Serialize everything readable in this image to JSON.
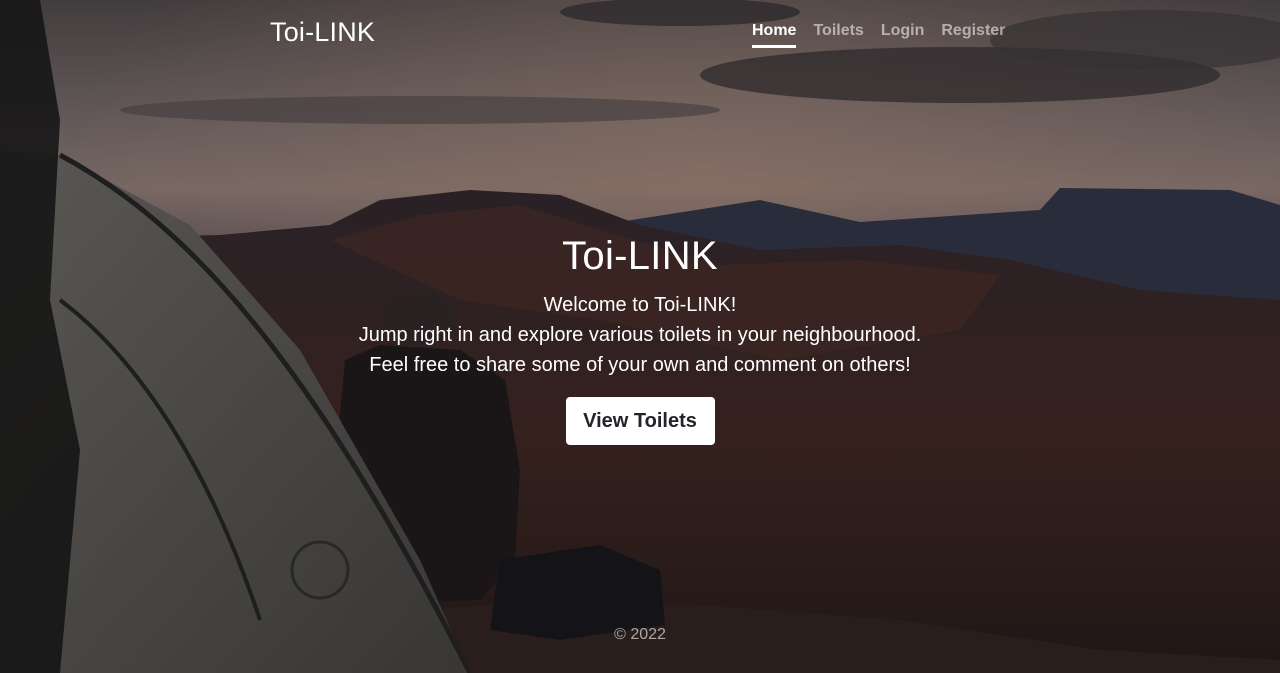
{
  "header": {
    "brand": "Toi-LINK",
    "nav": [
      {
        "label": "Home",
        "active": true
      },
      {
        "label": "Toilets",
        "active": false
      },
      {
        "label": "Login",
        "active": false
      },
      {
        "label": "Register",
        "active": false
      }
    ]
  },
  "hero": {
    "title": "Toi-LINK",
    "lines": [
      "Welcome to Toi-LINK!",
      "Jump right in and explore various toilets in your neighbourhood.",
      "Feel free to share some of your own and comment on others!"
    ],
    "button_label": "View Toilets"
  },
  "footer": {
    "copyright": "© 2022"
  },
  "colors": {
    "text": "#ffffff",
    "button_bg": "#ffffff",
    "button_text": "#212529"
  }
}
